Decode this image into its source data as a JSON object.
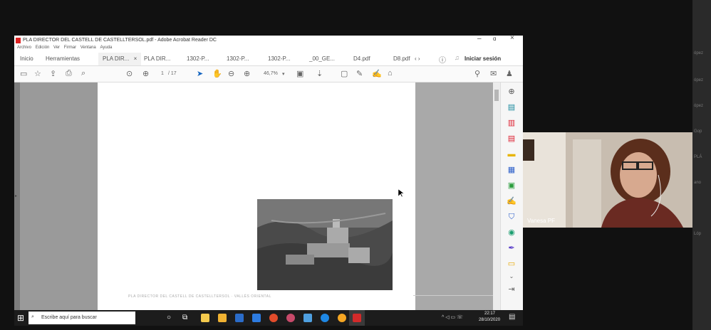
{
  "window": {
    "title": "PLA DIRECTOR DEL CASTELL DE CASTELLTERSOL.pdf - Adobe Acrobat Reader DC",
    "minimize": "–",
    "restore": "ɑ",
    "close": "×"
  },
  "menu": [
    "Archivo",
    "Edición",
    "Ver",
    "Firmar",
    "Ventana",
    "Ayuda"
  ],
  "tabs": {
    "home": "Inicio",
    "tools": "Herramientas",
    "doc1": "PLA DIR...",
    "doc1_close": "×",
    "doc2": "PLA DIR...",
    "doc3": "1302-P...",
    "doc4": "1302-P...",
    "doc5": "1302-P...",
    "doc6": "_00_GE...",
    "doc7": "D4.pdf",
    "doc8": "D8.pdf",
    "nav": "‹ ›",
    "sign_in": "Iniciar sesión"
  },
  "toolbar": {
    "page_current": "1",
    "page_total": "/ 17",
    "zoom": "46,7%",
    "zoom_caret": "▾"
  },
  "document": {
    "footer_text": "PLA DIRECTOR DEL CASTELL DE CASTELLTERSOL  ·  VALLÈS ORIENTAL"
  },
  "taskbar": {
    "search_placeholder": "Escribe aquí para buscar",
    "time": "22:17",
    "date": "28/10/2020"
  },
  "webcam": {
    "participant": "Vanesa PF"
  },
  "right_strip": [
    "ópez",
    "ópez",
    "ópez",
    "Gop",
    "PLÁ",
    "ano",
    "Lóp"
  ],
  "colors": {
    "acrobat_red": "#d22a2a",
    "tab_active": "#f1f1f1"
  }
}
